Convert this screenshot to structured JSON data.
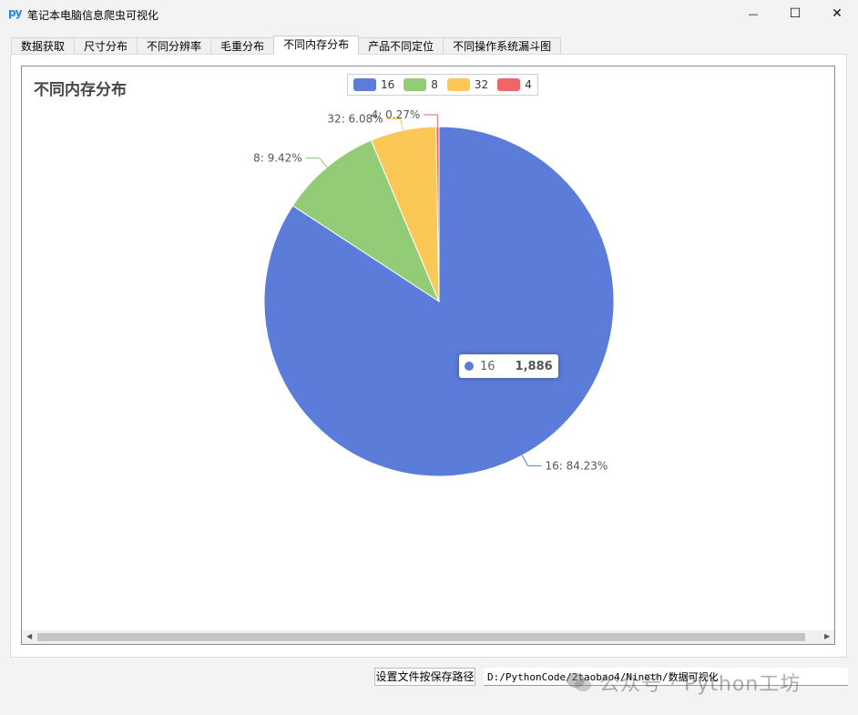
{
  "window": {
    "app_icon": "py",
    "title": "笔记本电脑信息爬虫可视化",
    "minimize_glyph": "—",
    "maximize_glyph": "☐",
    "close_glyph": "✕"
  },
  "tabs": [
    {
      "label": "数据获取"
    },
    {
      "label": "尺寸分布"
    },
    {
      "label": "不同分辨率"
    },
    {
      "label": "毛重分布"
    },
    {
      "label": "不同内存分布"
    },
    {
      "label": "产品不同定位"
    },
    {
      "label": "不同操作系统漏斗图"
    }
  ],
  "active_tab": 4,
  "chart_data": {
    "type": "pie",
    "title": "不同内存分布",
    "legend": {
      "placement": "top-center",
      "entries": [
        "16",
        "8",
        "32",
        "4"
      ]
    },
    "slices": [
      {
        "name": "16",
        "percent": 84.23,
        "color": "#5b7cd8",
        "label": "16: 84.23%"
      },
      {
        "name": "8",
        "percent": 9.42,
        "color": "#92cc76",
        "label": "8: 9.42%"
      },
      {
        "name": "32",
        "percent": 6.08,
        "color": "#fbc858",
        "label": "32: 6.08%"
      },
      {
        "name": "4",
        "percent": 0.27,
        "color": "#ef6666",
        "label": "4: 0.27%"
      }
    ],
    "tooltip": {
      "name": "16",
      "value": "1,886",
      "color": "#5b7cd8"
    }
  },
  "bottom": {
    "set_path_button": "设置文件按保存路径",
    "path_value": "D:/PythonCode/2taobao4/Nineth/数据可视化"
  },
  "watermark": {
    "text": "公众号 · Python工坊"
  }
}
